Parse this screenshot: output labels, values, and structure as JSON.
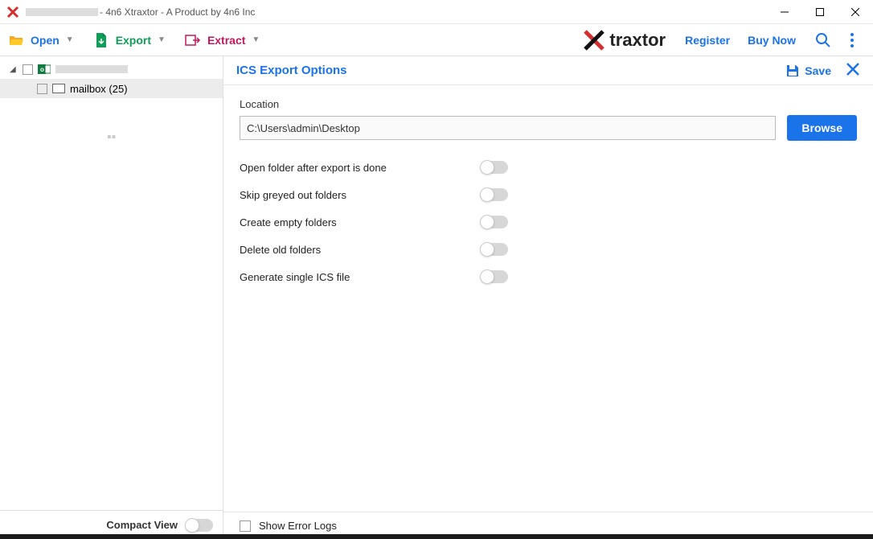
{
  "titlebar": {
    "app_title": " - 4n6 Xtraxtor - A Product by 4n6 Inc"
  },
  "toolbar": {
    "open_label": "Open",
    "export_label": "Export",
    "extract_label": "Extract",
    "register_label": "Register",
    "buy_now_label": "Buy Now",
    "logo_text": "traxtor"
  },
  "sidebar": {
    "root_obscured": true,
    "child_label": "mailbox  (25)",
    "compact_view_label": "Compact View"
  },
  "panel": {
    "title": "ICS Export Options",
    "save_label": "Save",
    "location_label": "Location",
    "location_value": "C:\\Users\\admin\\Desktop",
    "browse_label": "Browse",
    "options": [
      {
        "label": "Open folder after export is done"
      },
      {
        "label": "Skip greyed out folders"
      },
      {
        "label": "Create empty folders"
      },
      {
        "label": "Delete old folders"
      },
      {
        "label": "Generate single ICS file"
      }
    ],
    "show_error_logs_label": "Show Error Logs"
  }
}
